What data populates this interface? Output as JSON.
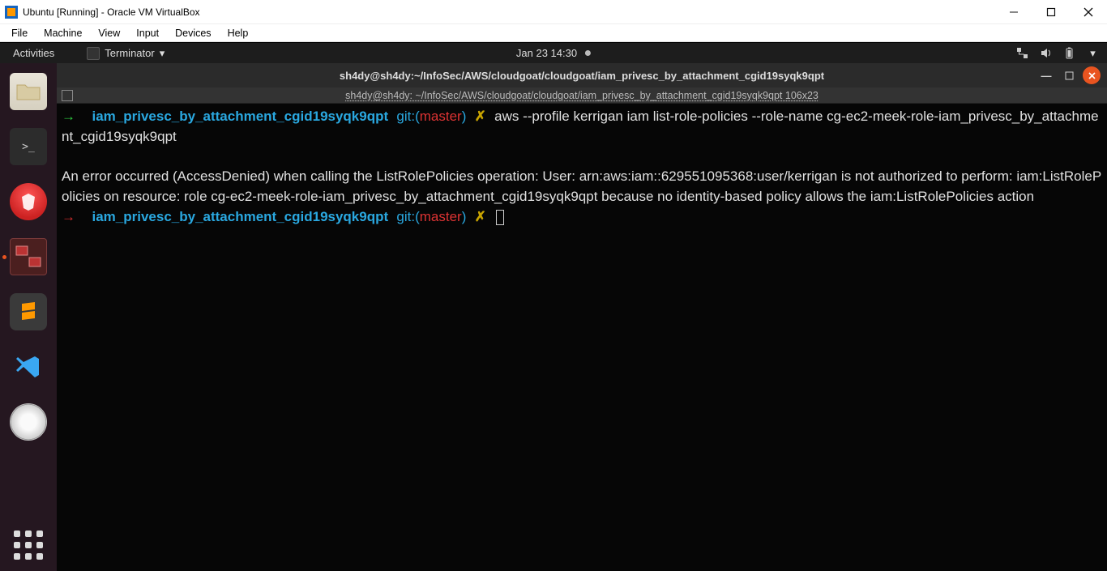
{
  "host": {
    "window_title": "Ubuntu [Running] - Oracle VM VirtualBox",
    "menu": [
      "File",
      "Machine",
      "View",
      "Input",
      "Devices",
      "Help"
    ]
  },
  "panel": {
    "activities": "Activities",
    "app_name": "Terminator",
    "datetime": "Jan 23  14:30"
  },
  "terminal": {
    "window_title": "sh4dy@sh4dy:~/InfoSec/AWS/cloudgoat/cloudgoat/iam_privesc_by_attachment_cgid19syqk9qpt",
    "tab_label": "sh4dy@sh4dy: ~/InfoSec/AWS/cloudgoat/cloudgoat/iam_privesc_by_attachment_cgid19syqk9qpt 106x23",
    "prompt1": {
      "arrow": "→",
      "dir": "iam_privesc_by_attachment_cgid19syqk9qpt",
      "git": "git:",
      "lp": "(",
      "branch": "master",
      "rp": ")",
      "x": "✗",
      "command": "aws --profile kerrigan iam list-role-policies --role-name cg-ec2-meek-role-iam_privesc_by_attachment_cgid19syqk9qpt"
    },
    "output": "An error occurred (AccessDenied) when calling the ListRolePolicies operation: User: arn:aws:iam::629551095368:user/kerrigan is not authorized to perform: iam:ListRolePolicies on resource: role cg-ec2-meek-role-iam_privesc_by_attachment_cgid19syqk9qpt because no identity-based policy allows the iam:ListRolePolicies action",
    "prompt2": {
      "arrow": "→",
      "dir": "iam_privesc_by_attachment_cgid19syqk9qpt",
      "git": "git:",
      "lp": "(",
      "branch": "master",
      "rp": ")",
      "x": "✗"
    }
  }
}
